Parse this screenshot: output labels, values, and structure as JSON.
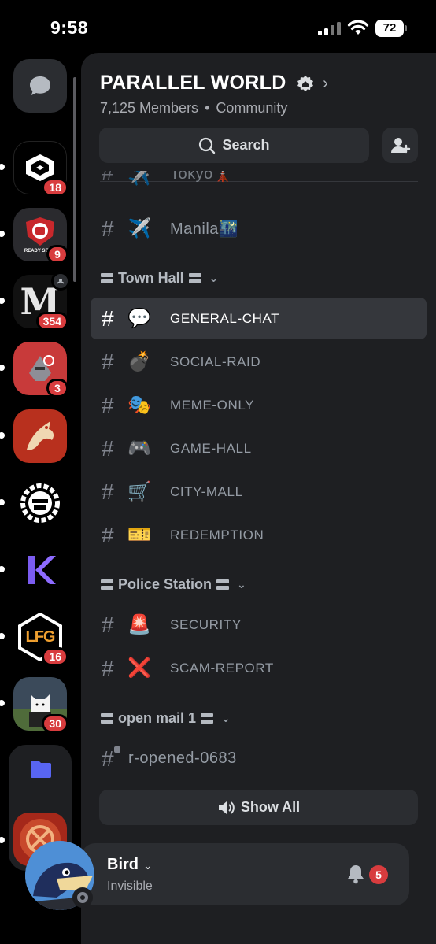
{
  "status_bar": {
    "time": "9:58",
    "battery": "72"
  },
  "servers": [
    {
      "name": "server-1",
      "badge": "18"
    },
    {
      "name": "server-2",
      "badge": "9",
      "caption": "READY SET R"
    },
    {
      "name": "server-3",
      "badge": "354",
      "glyph": "M"
    },
    {
      "name": "server-4",
      "badge": "3"
    },
    {
      "name": "server-5",
      "badge": ""
    },
    {
      "name": "server-6",
      "badge": ""
    },
    {
      "name": "server-7",
      "badge": "",
      "glyph": "K"
    },
    {
      "name": "server-8",
      "badge": "16",
      "glyph": "LFG"
    },
    {
      "name": "server-9",
      "badge": "30"
    }
  ],
  "guild": {
    "name": "PARALLEL WORLD",
    "members": "7,125 Members",
    "type": "Community",
    "search_label": "Search"
  },
  "channels_top": [
    {
      "name": "Tokyo🗼",
      "emoji": "✈️"
    },
    {
      "name": "Manila🌃",
      "emoji": "✈️"
    }
  ],
  "categories": [
    {
      "label": "Town Hall",
      "channels": [
        {
          "name": "GENERAL-CHAT",
          "emoji": "💬",
          "active": true
        },
        {
          "name": "SOCIAL-RAID",
          "emoji": "💣"
        },
        {
          "name": "MEME-ONLY",
          "emoji": "🎭"
        },
        {
          "name": "GAME-HALL",
          "emoji": "🎮"
        },
        {
          "name": "CITY-MALL",
          "emoji": "🛒"
        },
        {
          "name": "REDEMPTION",
          "emoji": "🎫"
        }
      ]
    },
    {
      "label": "Police Station",
      "channels": [
        {
          "name": "SECURITY",
          "emoji": "🚨"
        },
        {
          "name": "SCAM-REPORT",
          "emoji": "❌"
        }
      ]
    },
    {
      "label": "open mail 1",
      "channels": [
        {
          "name": "r-opened-0683",
          "emoji": ""
        }
      ]
    }
  ],
  "show_all_label": "Show All",
  "user": {
    "name": "Bird",
    "status": "Invisible",
    "notifications": "5"
  },
  "colors": {
    "accent": "#5865f2",
    "badge": "#d83c3e",
    "panel": "#1e1f22",
    "active": "#35373c"
  }
}
